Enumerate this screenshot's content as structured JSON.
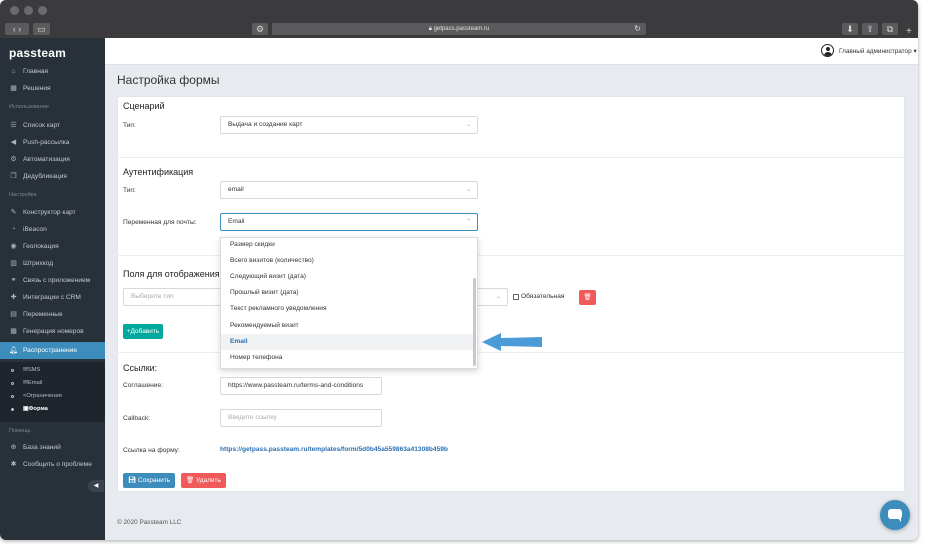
{
  "browser": {
    "url": "getpass.passteam.ru"
  },
  "sidebar": {
    "logo": "passteam",
    "items_top": [
      {
        "label": "Главная",
        "icon": "home-icon"
      },
      {
        "label": "Решения",
        "icon": "grid-icon"
      }
    ],
    "header_usage": "Использование",
    "items_usage": [
      {
        "label": "Список карт",
        "icon": "list-icon"
      },
      {
        "label": "Push-рассылка",
        "icon": "megaphone-icon"
      },
      {
        "label": "Автоматизация",
        "icon": "gear-icon"
      },
      {
        "label": "Дедубликация",
        "icon": "copy-icon"
      }
    ],
    "header_settings": "Настройка",
    "items_settings": [
      {
        "label": "Конструктор карт",
        "icon": "wrench-icon"
      },
      {
        "label": "iBeacon",
        "icon": "beacon-icon"
      },
      {
        "label": "Геолокация",
        "icon": "location-icon"
      },
      {
        "label": "Штрихкод",
        "icon": "barcode-icon"
      },
      {
        "label": "Связь с приложением",
        "icon": "link-icon"
      },
      {
        "label": "Интеграции с CRM",
        "icon": "puzzle-icon"
      },
      {
        "label": "Переменные",
        "icon": "variables-icon"
      },
      {
        "label": "Генерация номеров",
        "icon": "number-grid-icon"
      },
      {
        "label": "Распространение",
        "icon": "bell-icon"
      }
    ],
    "sub_items": [
      {
        "label": "SMS"
      },
      {
        "label": "Email"
      },
      {
        "label": "Ограничения"
      },
      {
        "label": "Форма"
      }
    ],
    "header_help": "Помощь",
    "items_help": [
      {
        "label": "База знаний",
        "icon": "globe-icon"
      },
      {
        "label": "Сообщить о проблеме",
        "icon": "bug-icon"
      }
    ]
  },
  "topbar": {
    "user": "Главный администратор"
  },
  "page": {
    "title": "Настройка формы"
  },
  "scenario": {
    "title": "Сценарий",
    "type_label": "Тип:",
    "type_value": "Выдача и создание карт"
  },
  "auth": {
    "title": "Аутентификация",
    "type_label": "Тип:",
    "type_value": "email",
    "variable_label": "Переменная для почты:",
    "variable_value": "Email",
    "options": [
      "Размер скидки",
      "Всего визитов (количество)",
      "Следующий визит (дата)",
      "Прошлый визит (дата)",
      "Текст рекламного уведомления",
      "Рекомендуемый визит",
      "Email",
      "Номер телефона"
    ],
    "selected_option": "Email"
  },
  "fields": {
    "title": "Поля для отображения",
    "type_placeholder": "Выберите тип",
    "required_label": "Обязательная",
    "add_button": "+Добавить"
  },
  "links": {
    "title": "Ссылки:",
    "agreement_label": "Соглашение:",
    "agreement_value": "https://www.passteam.ru/terms-and-conditions",
    "callback_label": "Callback:",
    "callback_placeholder": "Введите ссылку",
    "form_link_label": "Ссылка на форму:",
    "form_link_value": "https://getpass.passteam.ru/templates/form/5d0b45a559863a41308b459b"
  },
  "actions": {
    "save": "Сохранить",
    "delete": "Удалить"
  },
  "footer": {
    "copyright": "© 2020 Passteam LLC"
  },
  "colors": {
    "sidebar_bg": "#283039",
    "accent": "#3c8dbc",
    "add_button": "#00a89d",
    "danger": "#f05a5a",
    "link": "#2a6fb3"
  }
}
